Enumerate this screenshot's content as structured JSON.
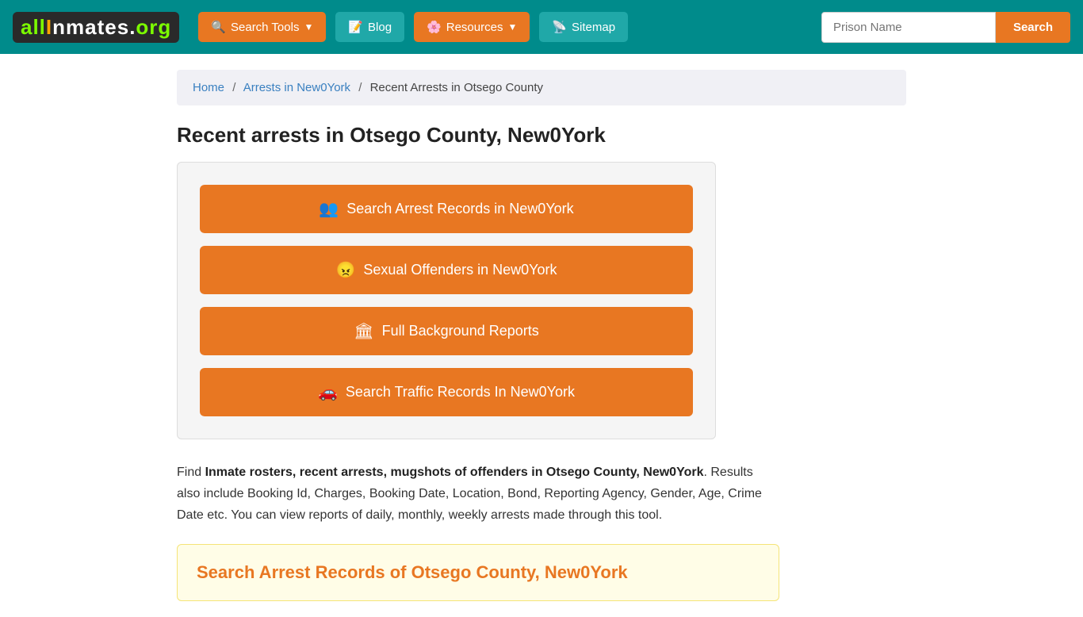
{
  "navbar": {
    "logo": "allInmates.org",
    "search_tools_label": "Search Tools",
    "blog_label": "Blog",
    "resources_label": "Resources",
    "sitemap_label": "Sitemap",
    "prison_input_placeholder": "Prison Name",
    "search_btn_label": "Search"
  },
  "breadcrumb": {
    "home": "Home",
    "arrests": "Arrests in New0York",
    "current": "Recent Arrests in Otsego County"
  },
  "page": {
    "title": "Recent arrests in Otsego County, New0York",
    "btn1": "Search Arrest Records in New0York",
    "btn2": "Sexual Offenders in New0York",
    "btn3": "Full Background Reports",
    "btn4": "Search Traffic Records In New0York",
    "description_prefix": "Find ",
    "description_bold": "Inmate rosters, recent arrests, mugshots of offenders in Otsego County, New0York",
    "description_suffix": ". Results also include Booking Id, Charges, Booking Date, Location, Bond, Reporting Agency, Gender, Age, Crime Date etc. You can view reports of daily, monthly, weekly arrests made through this tool.",
    "search_records_title": "Search Arrest Records of Otsego County, New0York"
  }
}
